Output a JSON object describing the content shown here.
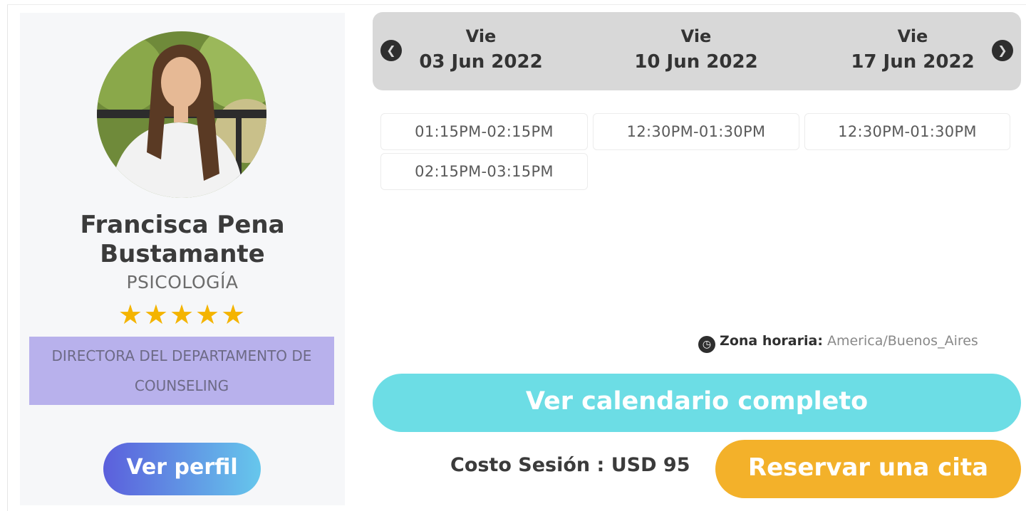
{
  "profile": {
    "name_line1": "Francisca Pena",
    "name_line2": "Bustamante",
    "specialty": "PSICOLOGÍA",
    "rating_stars": "★★★★★",
    "rating": 5,
    "role_line1": "DIRECTORA DEL DEPARTAMENTO DE",
    "role_line2": "COUNSELING",
    "view_profile_label": "Ver perfil"
  },
  "calendar": {
    "prev_icon": "chevron-left-icon",
    "next_icon": "chevron-right-icon",
    "days": [
      {
        "dow": "Vie",
        "date": "03 Jun 2022",
        "slots": [
          "01:15PM-02:15PM",
          "02:15PM-03:15PM"
        ]
      },
      {
        "dow": "Vie",
        "date": "10 Jun 2022",
        "slots": [
          "12:30PM-01:30PM"
        ]
      },
      {
        "dow": "Vie",
        "date": "17 Jun 2022",
        "slots": [
          "12:30PM-01:30PM"
        ]
      }
    ]
  },
  "timezone": {
    "icon": "clock-icon",
    "label": "Zona horaria:",
    "value": "America/Buenos_Aires"
  },
  "actions": {
    "full_calendar_label": "Ver calendario completo",
    "cost_label": "Costo Sesión : USD 95",
    "book_label": "Reservar una cita"
  },
  "colors": {
    "profile_button_gradient": [
      "#5b5fdc",
      "#66c7ec"
    ],
    "calendar_button": "#6cdde5",
    "book_button": "#f3b12a",
    "role_badge": "#b8b1ec",
    "stars": "#f4b400"
  }
}
